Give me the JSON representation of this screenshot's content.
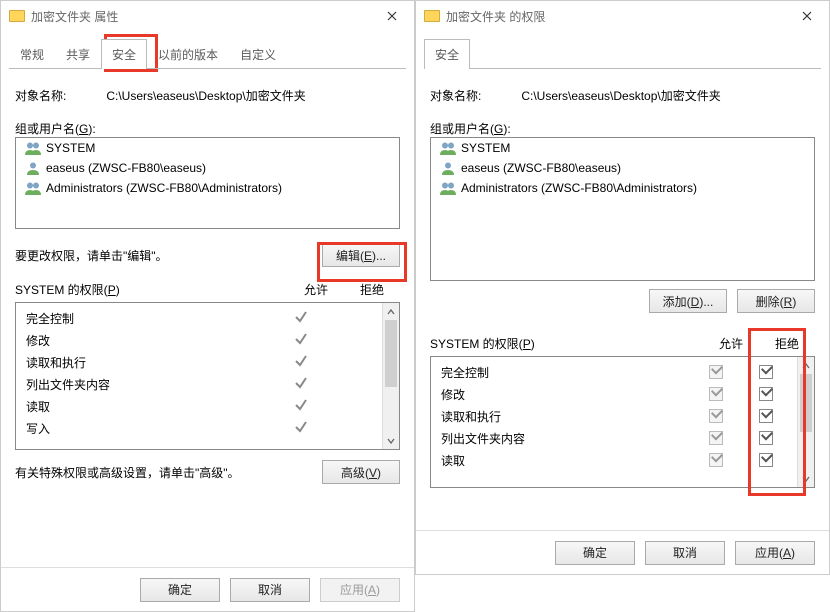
{
  "left": {
    "title": "加密文件夹 属性",
    "tabs": {
      "general": "常规",
      "sharing": "共享",
      "security": "安全",
      "previous": "以前的版本",
      "custom": "自定义"
    },
    "object_label": "对象名称:",
    "object_path": "C:\\Users\\easeus\\Desktop\\加密文件夹",
    "group_label_pre": "组或用户名(",
    "group_label_u": "G",
    "group_label_post": "):",
    "users": [
      {
        "name": "SYSTEM",
        "type": "group"
      },
      {
        "name": "easeus (ZWSC-FB80\\easeus)",
        "type": "user"
      },
      {
        "name": "Administrators (ZWSC-FB80\\Administrators)",
        "type": "group"
      }
    ],
    "edit_hint": "要更改权限，请单击\"编辑\"。",
    "edit_btn_pre": "编辑(",
    "edit_btn_u": "E",
    "edit_btn_post": ")...",
    "perm_label_pre": "SYSTEM 的权限(",
    "perm_label_u": "P",
    "perm_label_post": ")",
    "col_allow": "允许",
    "col_deny": "拒绝",
    "perms": [
      {
        "name": "完全控制",
        "allow": true,
        "deny": false
      },
      {
        "name": "修改",
        "allow": true,
        "deny": false
      },
      {
        "name": "读取和执行",
        "allow": true,
        "deny": false
      },
      {
        "name": "列出文件夹内容",
        "allow": true,
        "deny": false
      },
      {
        "name": "读取",
        "allow": true,
        "deny": false
      },
      {
        "name": "写入",
        "allow": true,
        "deny": false
      }
    ],
    "advanced_hint": "有关特殊权限或高级设置，请单击\"高级\"。",
    "advanced_btn_pre": "高级(",
    "advanced_btn_u": "V",
    "advanced_btn_post": ")",
    "ok": "确定",
    "cancel": "取消",
    "apply_pre": "应用(",
    "apply_u": "A",
    "apply_post": ")"
  },
  "right": {
    "title": "加密文件夹 的权限",
    "tab": "安全",
    "object_label": "对象名称:",
    "object_path": "C:\\Users\\easeus\\Desktop\\加密文件夹",
    "group_label_pre": "组或用户名(",
    "group_label_u": "G",
    "group_label_post": "):",
    "users": [
      {
        "name": "SYSTEM",
        "type": "group"
      },
      {
        "name": "easeus (ZWSC-FB80\\easeus)",
        "type": "user"
      },
      {
        "name": "Administrators (ZWSC-FB80\\Administrators)",
        "type": "group"
      }
    ],
    "add_btn_pre": "添加(",
    "add_btn_u": "D",
    "add_btn_post": ")...",
    "remove_btn_pre": "删除(",
    "remove_btn_u": "R",
    "remove_btn_post": ")",
    "perm_label_pre": "SYSTEM 的权限(",
    "perm_label_u": "P",
    "perm_label_post": ")",
    "col_allow": "允许",
    "col_deny": "拒绝",
    "perms": [
      {
        "name": "完全控制",
        "allow": true,
        "deny": true
      },
      {
        "name": "修改",
        "allow": true,
        "deny": true
      },
      {
        "name": "读取和执行",
        "allow": true,
        "deny": true
      },
      {
        "name": "列出文件夹内容",
        "allow": true,
        "deny": true
      },
      {
        "name": "读取",
        "allow": true,
        "deny": true
      }
    ],
    "ok": "确定",
    "cancel": "取消",
    "apply_pre": "应用(",
    "apply_u": "A",
    "apply_post": ")"
  }
}
